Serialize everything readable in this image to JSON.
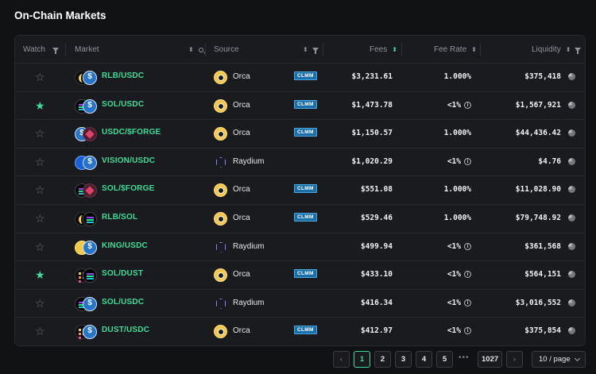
{
  "title": "On-Chain Markets",
  "headers": {
    "watch": "Watch",
    "market": "Market",
    "source": "Source",
    "fees": "Fees",
    "fee_rate": "Fee Rate",
    "liquidity": "Liquidity"
  },
  "colors": {
    "accent": "#3fdc9a",
    "clmm_badge": "#1a6fa8",
    "background": "#111214"
  },
  "rows": [
    {
      "watched": false,
      "tokens": [
        "rlb",
        "usdc"
      ],
      "market": "RLB/USDC",
      "source_icon": "orca",
      "source": "Orca",
      "badge": "CLMM",
      "fees": "$3,231.61",
      "fee_rate": "1.000%",
      "fee_info": false,
      "liquidity": "$375,418"
    },
    {
      "watched": true,
      "tokens": [
        "sol",
        "usdc"
      ],
      "market": "SOL/USDC",
      "source_icon": "orca",
      "source": "Orca",
      "badge": "CLMM",
      "fees": "$1,473.78",
      "fee_rate": "<1%",
      "fee_info": true,
      "liquidity": "$1,567,921"
    },
    {
      "watched": false,
      "tokens": [
        "usdc",
        "forge"
      ],
      "market": "USDC/$FORGE",
      "source_icon": "orca",
      "source": "Orca",
      "badge": "CLMM",
      "fees": "$1,150.57",
      "fee_rate": "1.000%",
      "fee_info": false,
      "liquidity": "$44,436.42"
    },
    {
      "watched": false,
      "tokens": [
        "vision",
        "usdc"
      ],
      "market": "VISION/USDC",
      "source_icon": "raydium",
      "source": "Raydium",
      "badge": "",
      "fees": "$1,020.29",
      "fee_rate": "<1%",
      "fee_info": true,
      "liquidity": "$4.76"
    },
    {
      "watched": false,
      "tokens": [
        "sol",
        "forge"
      ],
      "market": "SOL/$FORGE",
      "source_icon": "orca",
      "source": "Orca",
      "badge": "CLMM",
      "fees": "$551.08",
      "fee_rate": "1.000%",
      "fee_info": false,
      "liquidity": "$11,028.90"
    },
    {
      "watched": false,
      "tokens": [
        "rlb",
        "sol"
      ],
      "market": "RLB/SOL",
      "source_icon": "orca",
      "source": "Orca",
      "badge": "CLMM",
      "fees": "$529.46",
      "fee_rate": "1.000%",
      "fee_info": false,
      "liquidity": "$79,748.92"
    },
    {
      "watched": false,
      "tokens": [
        "king",
        "usdc"
      ],
      "market": "KING/USDC",
      "source_icon": "raydium",
      "source": "Raydium",
      "badge": "",
      "fees": "$499.94",
      "fee_rate": "<1%",
      "fee_info": true,
      "liquidity": "$361,568"
    },
    {
      "watched": true,
      "tokens": [
        "dust",
        "sol"
      ],
      "market": "SOL/DUST",
      "source_icon": "orca",
      "source": "Orca",
      "badge": "CLMM",
      "fees": "$433.10",
      "fee_rate": "<1%",
      "fee_info": true,
      "liquidity": "$564,151"
    },
    {
      "watched": false,
      "tokens": [
        "sol",
        "usdc"
      ],
      "market": "SOL/USDC",
      "source_icon": "raydium",
      "source": "Raydium",
      "badge": "",
      "fees": "$416.34",
      "fee_rate": "<1%",
      "fee_info": true,
      "liquidity": "$3,016,552"
    },
    {
      "watched": false,
      "tokens": [
        "dust",
        "usdc"
      ],
      "market": "DUST/USDC",
      "source_icon": "orca",
      "source": "Orca",
      "badge": "CLMM",
      "fees": "$412.97",
      "fee_rate": "<1%",
      "fee_info": true,
      "liquidity": "$375,854"
    }
  ],
  "pagination": {
    "prev": "‹",
    "next": "›",
    "pages": [
      "1",
      "2",
      "3",
      "4",
      "5"
    ],
    "current": "1",
    "ellipsis": "•••",
    "last": "1027",
    "page_size": "10 / page"
  }
}
